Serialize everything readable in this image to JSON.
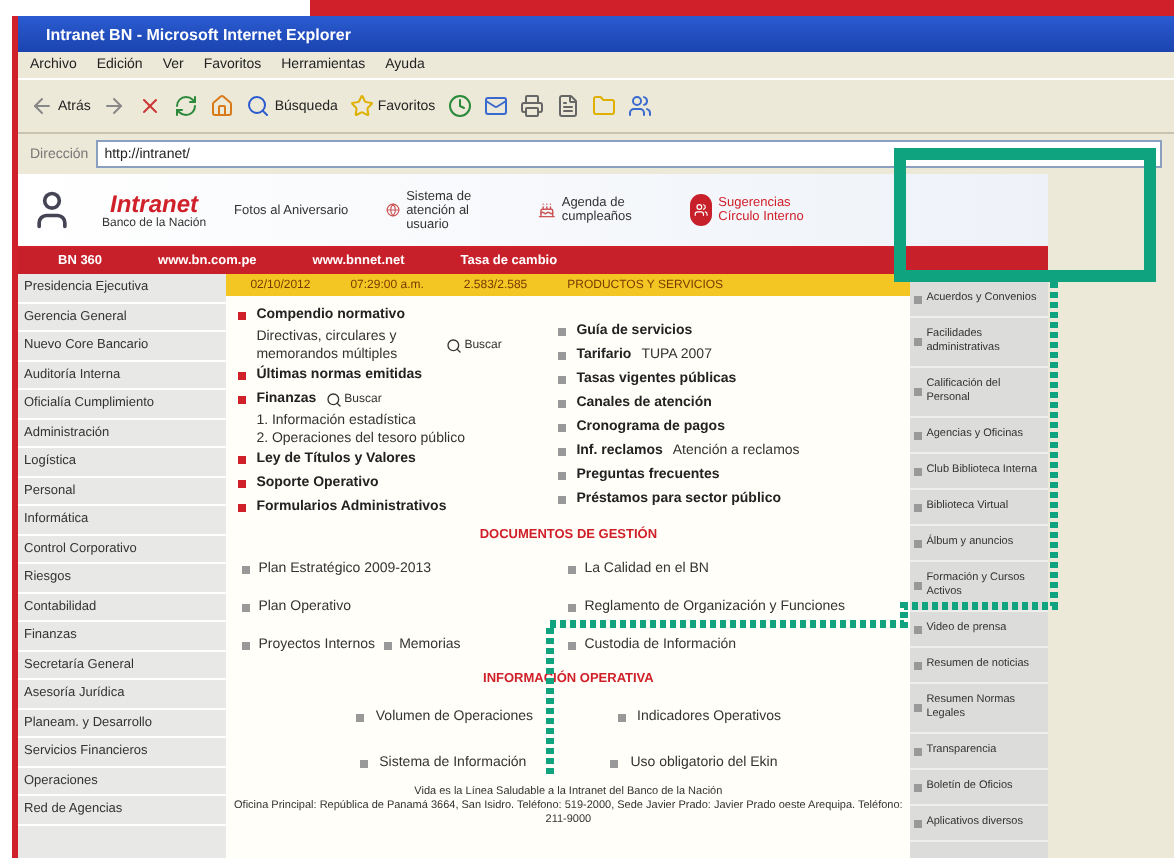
{
  "window": {
    "title": "Intranet BN - Microsoft Internet Explorer"
  },
  "menu": [
    "Archivo",
    "Edición",
    "Ver",
    "Favoritos",
    "Herramientas",
    "Ayuda"
  ],
  "toolbar": [
    {
      "kind": "back",
      "label": "Atrás"
    },
    {
      "kind": "forward"
    },
    {
      "kind": "stop"
    },
    {
      "kind": "refresh"
    },
    {
      "kind": "home"
    },
    {
      "kind": "search",
      "label": "Búsqueda"
    },
    {
      "kind": "favorites",
      "label": "Favoritos"
    },
    {
      "kind": "history"
    },
    {
      "kind": "mail"
    },
    {
      "kind": "print"
    },
    {
      "kind": "edit"
    },
    {
      "kind": "folder"
    },
    {
      "kind": "messenger"
    }
  ],
  "address": {
    "label": "Dirección",
    "value": "http://intranet/"
  },
  "banner": {
    "title": "Intranet",
    "subtitle": "Banco de la Nación",
    "links": [
      {
        "kind": "text",
        "text": "Fotos al Aniversario"
      },
      {
        "kind": "globe",
        "text": "Sistema de atención al usuario"
      },
      {
        "kind": "cake",
        "text": "Agenda de cumpleaños"
      },
      {
        "kind": "badge",
        "text": "Sugerencias Círculo Interno"
      }
    ]
  },
  "nav": [
    "BN 360",
    "www.bn.com.pe",
    "www.bnnet.net",
    "Tasa de cambio"
  ],
  "info_bar": [
    "02/10/2012",
    "07:29:00 a.m.",
    "2.583/2.585",
    "PRODUCTOS Y SERVICIOS"
  ],
  "sidebar": [
    "Presidencia Ejecutiva",
    "Gerencia General",
    "Nuevo Core Bancario",
    "Auditoría Interna",
    "Oficialía Cumplimiento",
    "Administración",
    "Logística",
    "Personal",
    "Informática",
    "Control Corporativo",
    "Riesgos",
    "Contabilidad",
    "Finanzas",
    "Secretaría General",
    "Asesoría Jurídica",
    "Planeam. y Desarrollo",
    "Servicios Financieros",
    "Operaciones",
    "Red de Agencias"
  ],
  "left_links": [
    {
      "text": "Compendio normativo",
      "bullet": true
    },
    {
      "text": "Directivas, circulares y memorandos múltiples",
      "bullet": false,
      "search": "Buscar"
    },
    {
      "text": "Últimas normas emitidas",
      "bullet": true
    },
    {
      "text": "Finanzas",
      "bullet": true,
      "search": "Buscar"
    },
    {
      "text": "1. Información estadística",
      "bullet": false
    },
    {
      "text": "2. Operaciones del tesoro público",
      "bullet": false
    },
    {
      "text": "Ley de Títulos y Valores",
      "bullet": true
    },
    {
      "text": "Soporte Operativo",
      "bullet": true
    },
    {
      "text": "Formularios Administrativos",
      "bullet": true
    }
  ],
  "right_links": [
    [
      "Guía de servicios"
    ],
    [
      "Tarifario",
      "TUPA 2007"
    ],
    [
      "Tasas vigentes públicas"
    ],
    [
      "Canales de atención"
    ],
    [
      "Cronograma de pagos"
    ],
    [
      "Inf. reclamos",
      "Atención a reclamos"
    ],
    [
      "Preguntas frecuentes"
    ],
    [
      "Préstamos para sector público"
    ]
  ],
  "documents": {
    "heading": "DOCUMENTOS DE GESTIÓN",
    "rows": [
      {
        "left": [
          "Plan Estratégico 2009-2013"
        ],
        "right": [
          "La Calidad en el BN"
        ]
      },
      {
        "left": [
          "Plan Operativo"
        ],
        "right": [
          "Reglamento de Organización y Funciones"
        ]
      },
      {
        "left": [
          "Proyectos Internos",
          "Memorias"
        ],
        "right": [
          "Custodia de Información"
        ]
      }
    ]
  },
  "operational": {
    "heading": "INFORMACIÓN OPERATIVA",
    "rows": [
      [
        "Volumen de Operaciones",
        "Indicadores Operativos"
      ],
      [
        "Sistema de Información",
        "Uso obligatorio del Ekin"
      ]
    ]
  },
  "footer": [
    "Vida es la Línea Saludable a la Intranet del Banco de la Nación",
    "Oficina Principal: República de Panamá 3664, San Isidro. Teléfono: 519-2000, Sede Javier Prado: Javier Prado oeste Arequipa. Teléfono: 211-9000"
  ],
  "right_sidebar": [
    "Acuerdos y Convenios",
    "Facilidades administrativas",
    "Calificación del Personal",
    "Agencias y Oficinas",
    "Club Biblioteca Interna",
    "Biblioteca Virtual",
    "Álbum y anuncios",
    "Formación y Cursos Activos",
    "Video de prensa",
    "Resumen de noticias",
    "Resumen Normas Legales",
    "Transparencia",
    "Boletín de Oficios",
    "Aplicativos diversos"
  ]
}
